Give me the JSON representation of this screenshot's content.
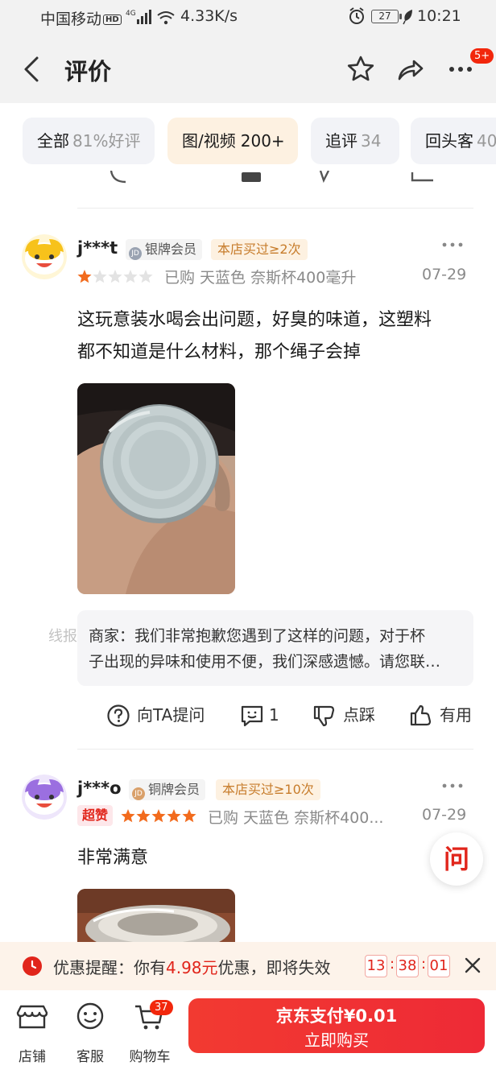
{
  "status_bar": {
    "carrier": "中国移动",
    "hd": "HD",
    "network": "4G",
    "speed": "4.33K/s",
    "battery": "27",
    "time": "10:21"
  },
  "header": {
    "title": "评价",
    "more_badge": "5+"
  },
  "tabs": [
    {
      "label": "全部",
      "count": "81%好评",
      "active": false
    },
    {
      "label": "图/视频",
      "count": "200+",
      "active": true
    },
    {
      "label": "追评",
      "count": "34",
      "active": false
    },
    {
      "label": "回头客",
      "count": "40",
      "active": false
    }
  ],
  "reviews": [
    {
      "user": "j***t",
      "member_level": "银牌会员",
      "rebuy_tag": "本店买过≥2次",
      "rating": 1,
      "purchase": "已购 天蓝色 奈斯杯400毫升",
      "date": "07-29",
      "text_line1": "这玩意装水喝会出问题，好臭的味道，这塑料",
      "text_line2": "都不知道是什么材料，那个绳子会掉",
      "merchant_reply_line1": "商家：我们非常抱歉您遇到了这样的问题，对于杯",
      "merchant_reply_line2": "子出现的异味和使用不便，我们深感遗憾。请您联…",
      "actions": {
        "ask": "向TA提问",
        "comments": "1",
        "dislike": "点踩",
        "like": "有用"
      }
    },
    {
      "user": "j***o",
      "member_level": "铜牌会员",
      "rebuy_tag": "本店买过≥10次",
      "super_like": "超赞",
      "rating": 5,
      "purchase": "已购 天蓝色 奈斯杯400...",
      "date": "07-29",
      "text": "非常满意"
    }
  ],
  "watermark": "线报酷 www.xianbaoku.cn",
  "ask_fab": "问",
  "promo": {
    "prefix": "优惠提醒：你有",
    "amount": "4.98元",
    "suffix": "优惠，即将失效",
    "timer_h": "13",
    "timer_m": "38",
    "timer_s": "01",
    "separator": ":"
  },
  "bottom_bar": {
    "shop": "店铺",
    "service": "客服",
    "cart": "购物车",
    "cart_count": "37",
    "buy_line1": "京东支付¥0.01",
    "buy_line2": "立即购买"
  },
  "colors": {
    "brand_red": "#e1251b",
    "star_orange": "#f26b1d",
    "active_tab_bg": "#fdf1e1"
  }
}
